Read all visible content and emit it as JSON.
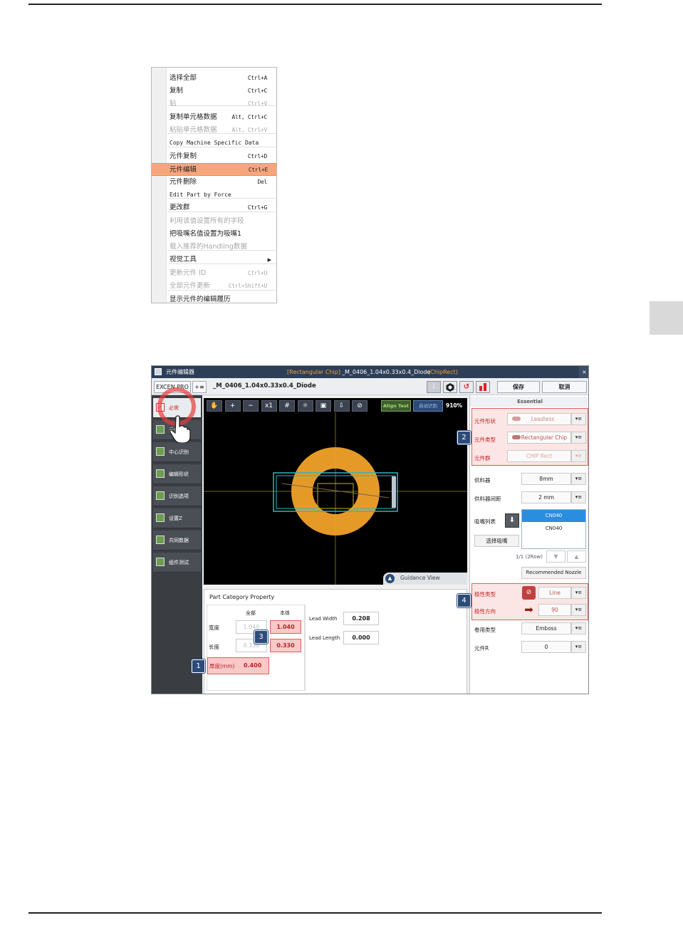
{
  "context_menu": {
    "items": [
      {
        "label": "选择全部",
        "shortcut": "Ctrl+A",
        "state": "normal"
      },
      {
        "label": "复制",
        "shortcut": "Ctrl+C",
        "state": "normal"
      },
      {
        "label": "贴",
        "shortcut": "Ctrl+V",
        "state": "disabled"
      },
      {
        "label": "复制单元格数据",
        "shortcut": "Alt, Ctrl+C",
        "state": "normal"
      },
      {
        "label": "粘贴单元格数据",
        "shortcut": "Alt, Ctrl+V",
        "state": "disabled"
      },
      {
        "label": "Copy Machine Specific Data",
        "shortcut": "",
        "state": "mono"
      },
      {
        "label": "元件复制",
        "shortcut": "Ctrl+D",
        "state": "normal"
      },
      {
        "label": "元件编辑",
        "shortcut": "Ctrl+E",
        "state": "highlighted"
      },
      {
        "label": "元件删除",
        "shortcut": "Del",
        "state": "normal"
      },
      {
        "label": "Edit Part by Force",
        "shortcut": "",
        "state": "mono"
      },
      {
        "label": "更改群",
        "shortcut": "Ctrl+G",
        "state": "normal"
      },
      {
        "label": "利用该值设置所有的字段",
        "shortcut": "",
        "state": "disabled"
      },
      {
        "label": "把吸嘴名值设置为吸嘴1",
        "shortcut": "",
        "state": "normal"
      },
      {
        "label": "载入推荐的Handling数据",
        "shortcut": "",
        "state": "disabled"
      },
      {
        "label": "视觉工具",
        "shortcut": "",
        "state": "submenu"
      },
      {
        "label": "更新元件 ID",
        "shortcut": "Ctrl+U",
        "state": "disabled"
      },
      {
        "label": "全部元件更新",
        "shortcut": "Ctrl+Shift+U",
        "state": "disabled"
      },
      {
        "label": "显示元件的编辑履历",
        "shortcut": "",
        "state": "normal"
      }
    ]
  },
  "app": {
    "window_title": "元件编辑器",
    "title_category": "[Rectangular Chip]",
    "title_part": "_M_0406_1.04x0.33x0.4_Diode",
    "title_type": "(ChipRect)",
    "close": "×",
    "toolbar": {
      "machine": "EXCEN PRO",
      "menu_btn": "+≡",
      "part_name": "_M_0406_1.04x0.33x0.4_Diode",
      "save": "保存",
      "cancel": "取消",
      "info": "i"
    },
    "sidebar": [
      {
        "label": "必需",
        "icon": "check-icon"
      },
      {
        "label": "元件",
        "icon": "gear-icon"
      },
      {
        "label": "中心识别",
        "icon": "center-icon"
      },
      {
        "label": "编辑形状",
        "icon": "shape-icon"
      },
      {
        "label": "识别选项",
        "icon": "options-icon"
      },
      {
        "label": "设置Z",
        "icon": "z-icon"
      },
      {
        "label": "共同数据",
        "icon": "common-icon"
      },
      {
        "label": "组件测试",
        "icon": "test-icon"
      }
    ],
    "view": {
      "tools": [
        "✋",
        "+",
        "−",
        "x1",
        "#",
        "☼",
        "▣",
        "⇩",
        "⊘"
      ],
      "align_test": "Align Test",
      "auto_recog": "自动识别",
      "zoom": "910%",
      "guidance": "Guidance View"
    },
    "part_category": {
      "title": "Part Category Property",
      "col_all": "全部",
      "col_body": "本体",
      "width_label": "宽度",
      "length_label": "长度",
      "thickness_label": "厚度(mm)",
      "width_all": "1.040",
      "width_body": "1.040",
      "length_all": "0.330",
      "length_body": "0.330",
      "thickness": "0.400",
      "lead_width_label": "Lead Width",
      "lead_width": "0.208",
      "lead_length_label": "Lead Length",
      "lead_length": "0.000"
    },
    "essential": {
      "header": "Essential",
      "shape_label": "元件形状",
      "shape_value": "Leadless",
      "type_label": "元件类型",
      "type_value": "Rectangular Chip",
      "group_label": "元件群",
      "group_value": "CHIP Rect",
      "feeder_label": "供料器",
      "feeder_value": "8mm",
      "pitch_label": "供料器间距",
      "pitch_value": "2 mm",
      "nozzle_label": "吸嘴列表",
      "nozzle_items": [
        "CN040",
        "CN040"
      ],
      "select_nozzle": "选择吸嘴",
      "page": "1/1 (2Row)",
      "recommended": "Recommended Nozzle",
      "polarity_type_label": "极性类型",
      "polarity_type_value": "Line",
      "polarity_dir_label": "极性方向",
      "polarity_dir_value": "90",
      "tape_label": "卷用类型",
      "tape_value": "Emboss",
      "r_label": "元件R",
      "r_value": "0",
      "dd": "▾≡"
    },
    "badges": [
      "1",
      "2",
      "3",
      "4"
    ]
  }
}
